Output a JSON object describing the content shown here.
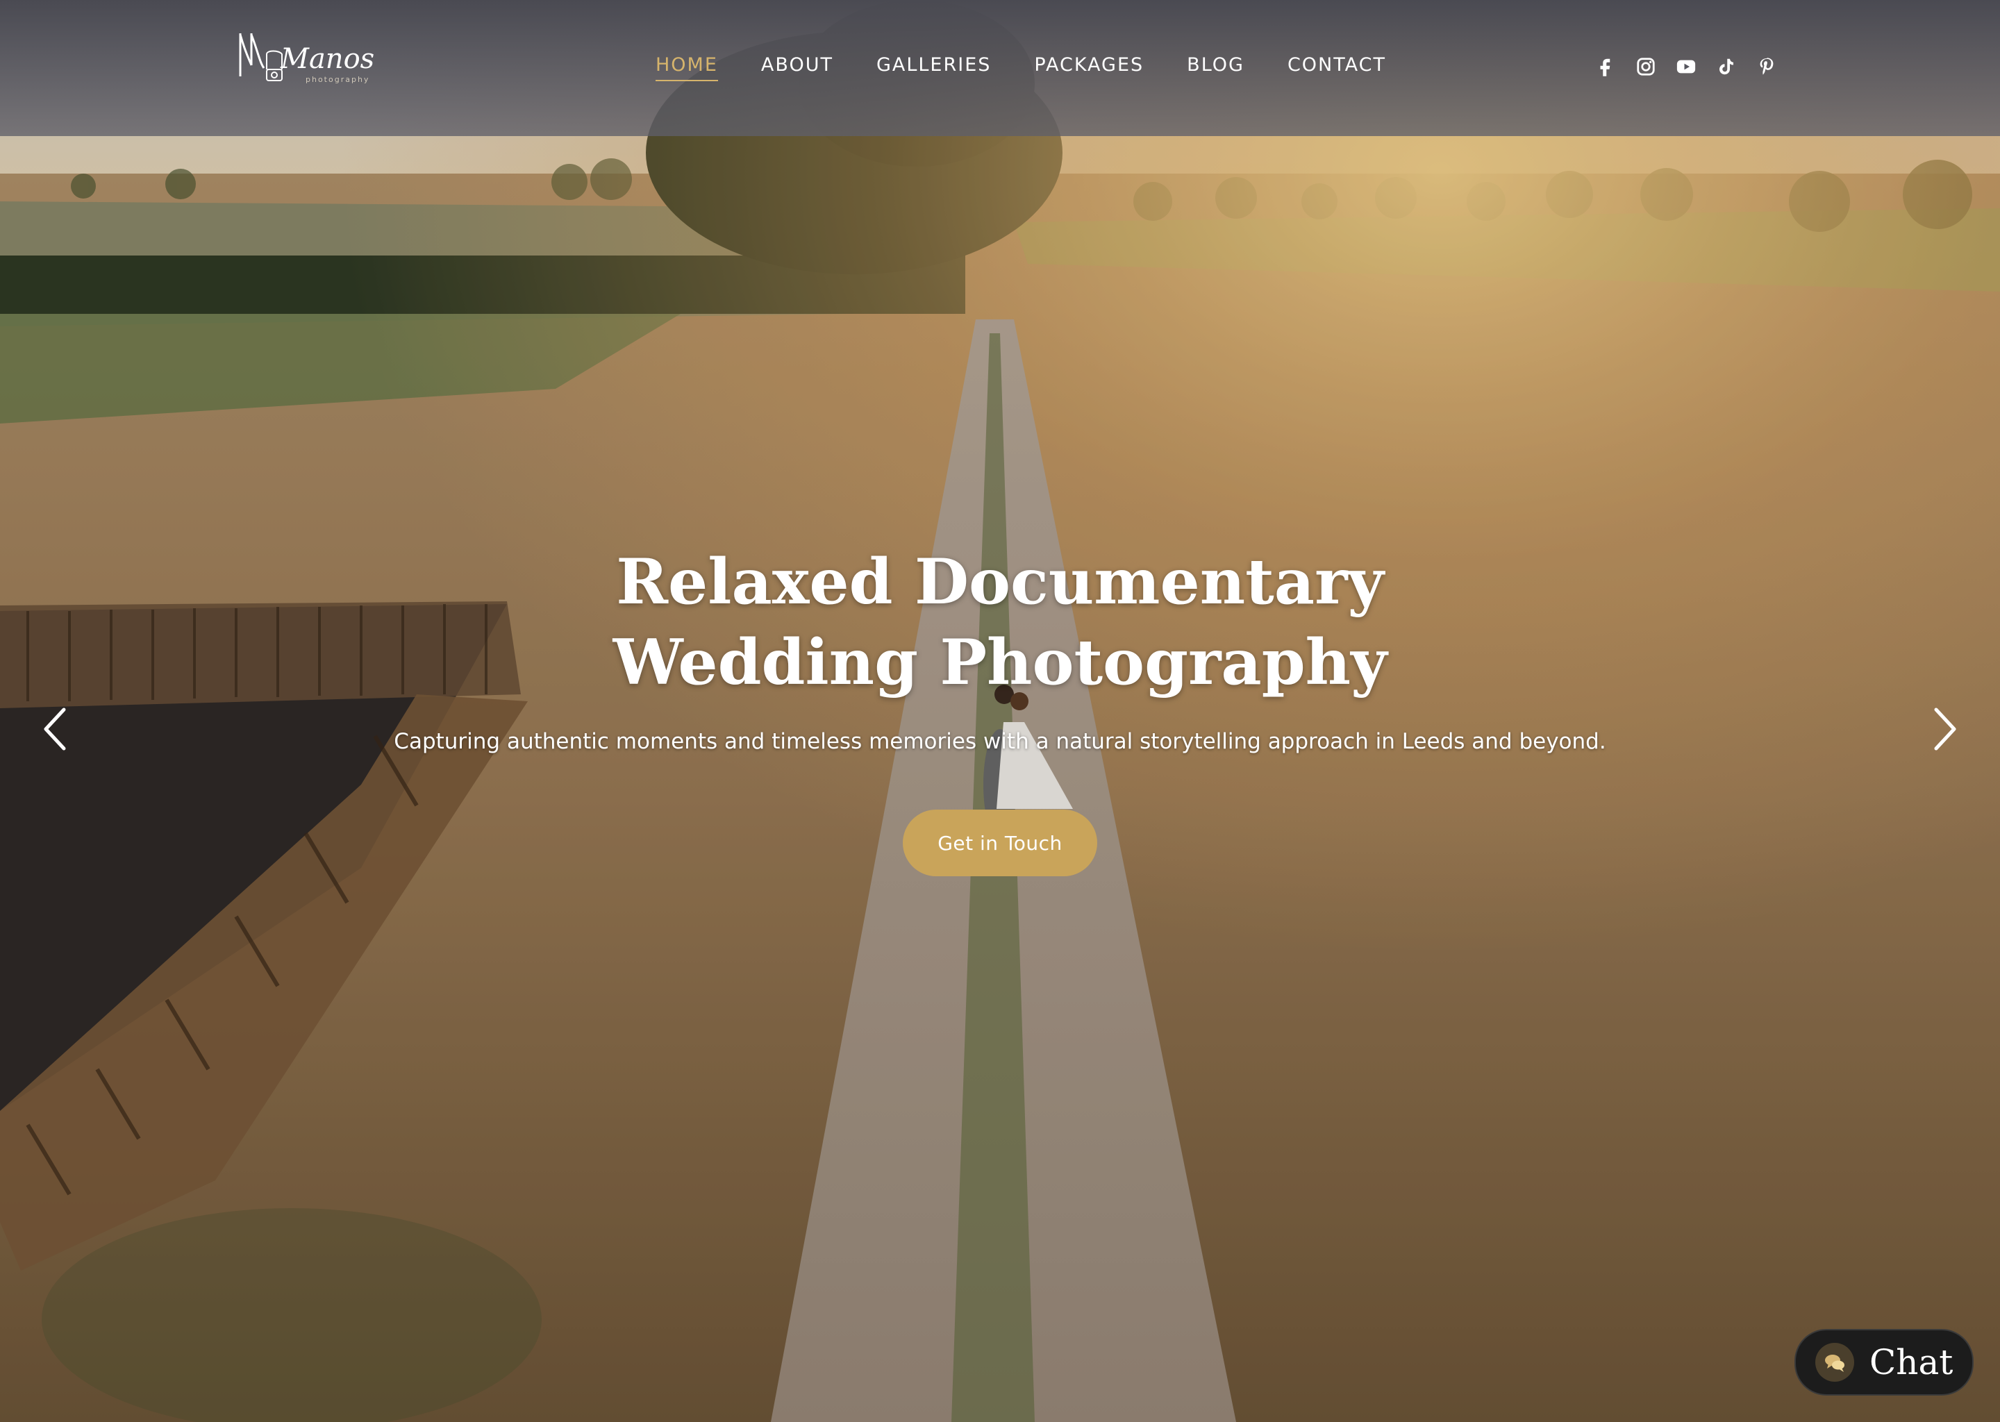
{
  "brand": {
    "logo_text": "Manos",
    "logo_subtext": "photography"
  },
  "nav": {
    "items": [
      {
        "label": "HOME",
        "active": true
      },
      {
        "label": "ABOUT",
        "active": false
      },
      {
        "label": "GALLERIES",
        "active": false
      },
      {
        "label": "PACKAGES",
        "active": false
      },
      {
        "label": "BLOG",
        "active": false
      },
      {
        "label": "CONTACT",
        "active": false
      }
    ]
  },
  "social": {
    "icons": [
      "facebook-icon",
      "instagram-icon",
      "youtube-icon",
      "tiktok-icon",
      "pinterest-icon"
    ]
  },
  "hero": {
    "title_line1": "Relaxed Documentary",
    "title_line2": "Wedding Photography",
    "subtitle": "Capturing authentic moments and timeless memories with a natural storytelling approach in Leeds and beyond.",
    "cta_label": "Get in Touch"
  },
  "chat": {
    "label": "Chat"
  },
  "colors": {
    "accent": "#c9a45a",
    "nav_active": "#d6b46c",
    "chat_bg": "#1c1c1c"
  }
}
